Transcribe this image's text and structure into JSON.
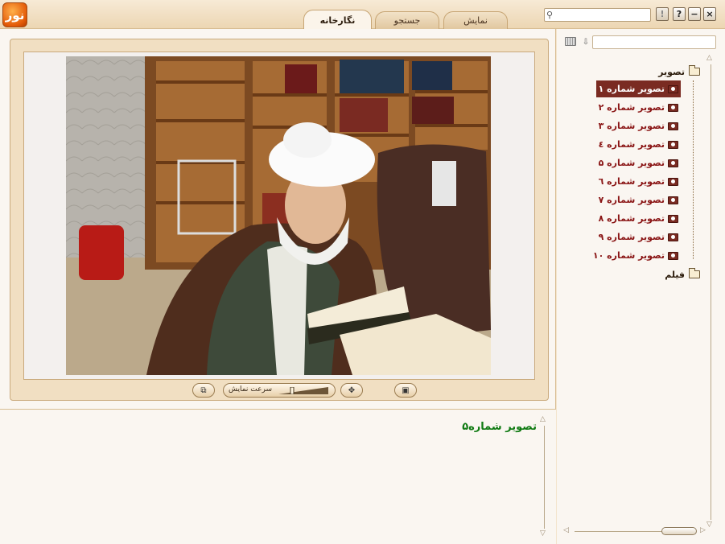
{
  "app": {
    "logo_text": "نور"
  },
  "tabs": [
    {
      "label": "نگارخانه",
      "active": true
    },
    {
      "label": "جستجو",
      "active": false
    },
    {
      "label": "نمایش",
      "active": false
    }
  ],
  "header": {
    "search_placeholder": "",
    "help_label": "?",
    "info_label": "!",
    "minimize_label": "−",
    "close_label": "×"
  },
  "viewer": {
    "speed_label": "سرعت نمایش",
    "speed_level": 0.25,
    "photo_alt": "تصویر شماره ۵"
  },
  "description": {
    "text": "تصویر شماره۵"
  },
  "sidebar": {
    "filter_placeholder": "",
    "tree": {
      "root_label": "تصویر",
      "items": [
        {
          "label": "تصویر شماره ۱",
          "selected": true
        },
        {
          "label": "تصویر شماره ۲",
          "selected": false
        },
        {
          "label": "تصویر شماره ۳",
          "selected": false
        },
        {
          "label": "تصویر شماره ٤",
          "selected": false
        },
        {
          "label": "تصویر شماره ۵",
          "selected": false
        },
        {
          "label": "تصویر شماره ٦",
          "selected": false
        },
        {
          "label": "تصویر شماره ۷",
          "selected": false
        },
        {
          "label": "تصویر شماره ۸",
          "selected": false
        },
        {
          "label": "تصویر شماره ۹",
          "selected": false
        },
        {
          "label": "تصویر شماره ۱۰",
          "selected": false
        }
      ],
      "second_root_label": "فیلم"
    }
  },
  "colors": {
    "accent": "#7a2b22",
    "item_text": "#8a1515",
    "desc_text": "#0f7a12",
    "frame": "#f1dfc2"
  }
}
